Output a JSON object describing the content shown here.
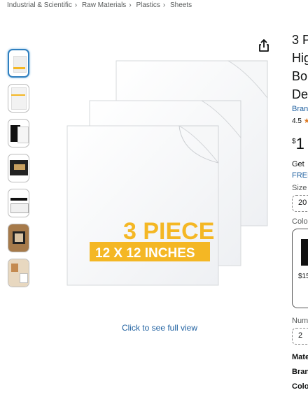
{
  "breadcrumb": [
    "Industrial & Scientific",
    "Raw Materials",
    "Plastics",
    "Sheets"
  ],
  "product_image": {
    "badge_count": "3 PIECE",
    "badge_size": "12 X 12 INCHES",
    "see_full_view": "Click to see full view"
  },
  "right_panel": {
    "title_lines": [
      "3 P",
      "Hig",
      "Bo",
      "De"
    ],
    "brand": "Bran",
    "rating": "4.5",
    "price_symbol": "$",
    "price_whole": "1",
    "get": "Get",
    "free": "FREE",
    "size_label": "Size",
    "size_value": "20",
    "color_label": "Colo",
    "swatch_price": "$15",
    "qty_label": "Num",
    "qty_value": "2",
    "spec_labels": [
      "Mate",
      "Bran",
      "Colo"
    ]
  },
  "colors": {
    "accent": "#f4b724",
    "link": "#2162a1",
    "star": "#de7921"
  }
}
